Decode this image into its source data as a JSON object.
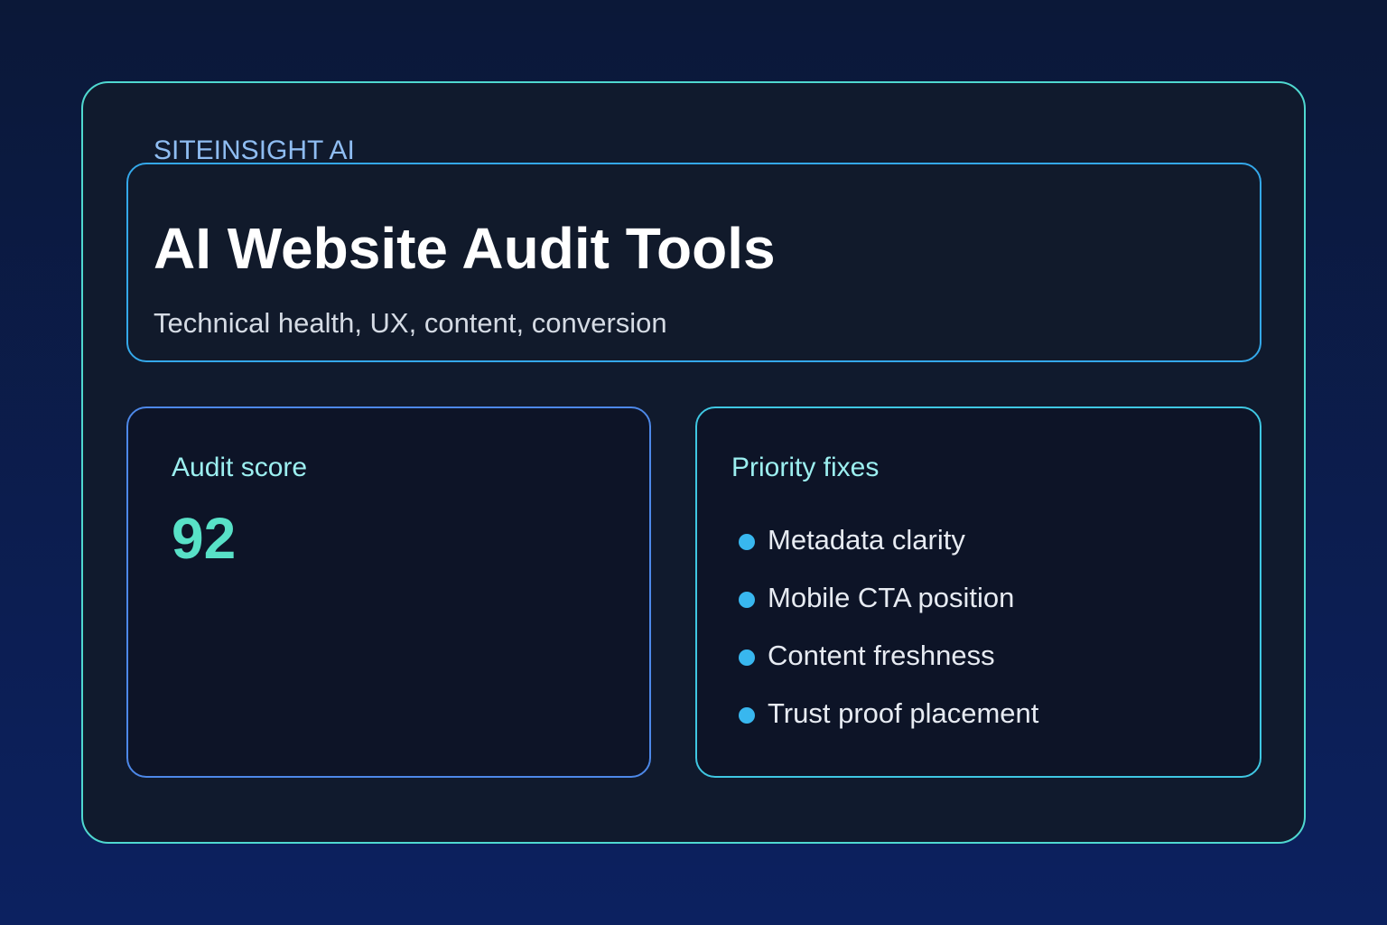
{
  "brand": {
    "name": "SITEINSIGHT AI"
  },
  "hero": {
    "title": "AI Website Audit Tools",
    "subtitle": "Technical health, UX, content, conversion"
  },
  "score_panel": {
    "label": "Audit score",
    "value": "92"
  },
  "fixes_panel": {
    "label": "Priority fixes",
    "items": [
      {
        "label": "Metadata clarity"
      },
      {
        "label": "Mobile CTA position"
      },
      {
        "label": "Content freshness"
      },
      {
        "label": "Trust proof placement"
      }
    ]
  },
  "colors": {
    "background_top": "#0b1838",
    "background_bottom": "#0c2160",
    "outer_border": "#4fd8d0",
    "hero_border": "#34a8ea",
    "score_border": "#4d88e8",
    "fixes_border": "#3fc7e2",
    "brand_text": "#8fbdf2",
    "panel_label": "#9ceff0",
    "score_value": "#58e1c7",
    "bullet": "#38b7ef"
  },
  "icons": {
    "bullet": "bullet-dot-icon"
  }
}
